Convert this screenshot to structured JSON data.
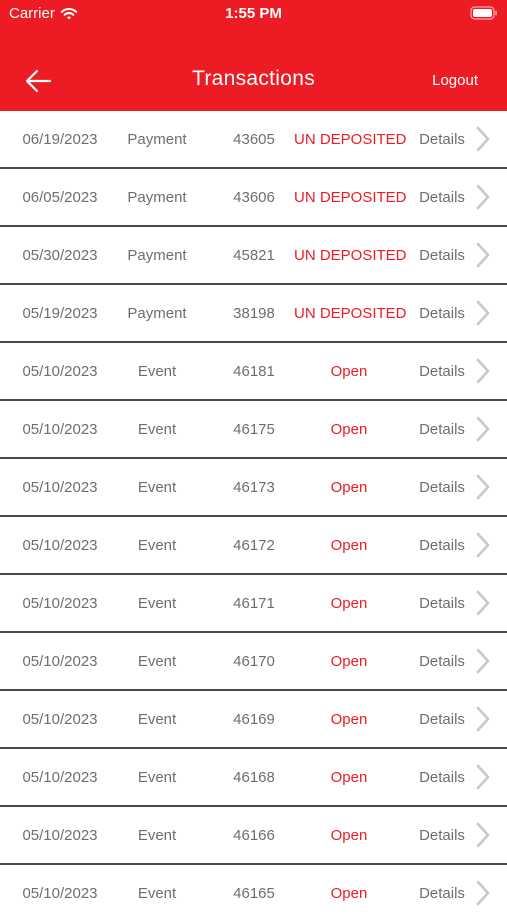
{
  "status_bar": {
    "carrier": "Carrier",
    "time": "1:55 PM"
  },
  "nav": {
    "title": "Transactions",
    "logout_label": "Logout",
    "back_icon": "arrow-left-icon"
  },
  "colors": {
    "brand": "#ed1c24",
    "status_text": "#ed1c24",
    "row_text": "#6e6e6e",
    "divider": "#4a4a4a"
  },
  "transactions": [
    {
      "date": "06/19/2023",
      "type": "Payment",
      "number": "43605",
      "status": "UN DEPOSITED",
      "details": "Details"
    },
    {
      "date": "06/05/2023",
      "type": "Payment",
      "number": "43606",
      "status": "UN DEPOSITED",
      "details": "Details"
    },
    {
      "date": "05/30/2023",
      "type": "Payment",
      "number": "45821",
      "status": "UN DEPOSITED",
      "details": "Details"
    },
    {
      "date": "05/19/2023",
      "type": "Payment",
      "number": "38198",
      "status": "UN DEPOSITED",
      "details": "Details"
    },
    {
      "date": "05/10/2023",
      "type": "Event",
      "number": "46181",
      "status": "Open",
      "details": "Details"
    },
    {
      "date": "05/10/2023",
      "type": "Event",
      "number": "46175",
      "status": "Open",
      "details": "Details"
    },
    {
      "date": "05/10/2023",
      "type": "Event",
      "number": "46173",
      "status": "Open",
      "details": "Details"
    },
    {
      "date": "05/10/2023",
      "type": "Event",
      "number": "46172",
      "status": "Open",
      "details": "Details"
    },
    {
      "date": "05/10/2023",
      "type": "Event",
      "number": "46171",
      "status": "Open",
      "details": "Details"
    },
    {
      "date": "05/10/2023",
      "type": "Event",
      "number": "46170",
      "status": "Open",
      "details": "Details"
    },
    {
      "date": "05/10/2023",
      "type": "Event",
      "number": "46169",
      "status": "Open",
      "details": "Details"
    },
    {
      "date": "05/10/2023",
      "type": "Event",
      "number": "46168",
      "status": "Open",
      "details": "Details"
    },
    {
      "date": "05/10/2023",
      "type": "Event",
      "number": "46166",
      "status": "Open",
      "details": "Details"
    },
    {
      "date": "05/10/2023",
      "type": "Event",
      "number": "46165",
      "status": "Open",
      "details": "Details"
    }
  ]
}
